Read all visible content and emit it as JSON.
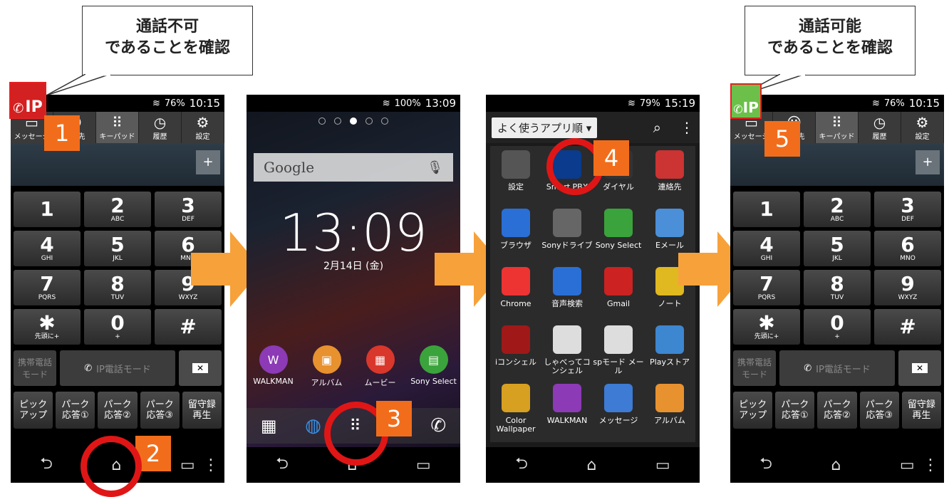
{
  "callouts": {
    "left": {
      "line1": "通話不可",
      "line2": "であることを確認"
    },
    "right": {
      "line1": "通話可能",
      "line2": "であることを確認"
    }
  },
  "steps": [
    "1",
    "2",
    "3",
    "4",
    "5"
  ],
  "dialer": {
    "status_time": "10:15",
    "battery": "76%",
    "tabs": [
      "メッセージ",
      "連絡先",
      "キーパッド",
      "履歴",
      "設定"
    ],
    "keys": [
      {
        "d": "1",
        "l": ""
      },
      {
        "d": "2",
        "l": "ABC"
      },
      {
        "d": "3",
        "l": "DEF"
      },
      {
        "d": "4",
        "l": "GHI"
      },
      {
        "d": "5",
        "l": "JKL"
      },
      {
        "d": "6",
        "l": "MNO"
      },
      {
        "d": "7",
        "l": "PQRS"
      },
      {
        "d": "8",
        "l": "TUV"
      },
      {
        "d": "9",
        "l": "WXYZ"
      },
      {
        "d": "✱",
        "l": "先頭に+"
      },
      {
        "d": "0",
        "l": "+"
      },
      {
        "d": "#",
        "l": ""
      }
    ],
    "mode_left": "携帯電話\nモード",
    "mode_center": "IP電話モード",
    "soft": [
      "ピック\nアップ",
      "パーク\n応答①",
      "パーク\n応答②",
      "パーク\n応答③",
      "留守録\n再生"
    ],
    "ip_off_label": "IP",
    "ip_on_label": "IP"
  },
  "home": {
    "status_time": "13:09",
    "battery": "100%",
    "search_label": "Google",
    "clock": "13:09",
    "date": "2月14日 (金)",
    "apps": [
      "WALKMAN",
      "アルバム",
      "ムービー",
      "Sony Select"
    ]
  },
  "drawer": {
    "status_time": "15:19",
    "battery": "79%",
    "sort_label": "よく使うアプリ順 ▾",
    "apps": [
      "設定",
      "Smart PBX",
      "ダイヤル",
      "連絡先",
      "ブラウザ",
      "Sonyドライブ",
      "Sony Select",
      "Eメール",
      "Chrome",
      "音声検索",
      "Gmail",
      "ノート",
      "iコンシェル",
      "しゃべってコンシェル",
      "spモード メール",
      "Playストア",
      "Color Wallpaper",
      "WALKMAN",
      "メッセージ",
      "アルバム"
    ]
  },
  "colors": {
    "accent_orange": "#f26d1b",
    "arrow": "#f7a13a",
    "highlight_red": "#e01616",
    "ip_on": "#6cc04a",
    "ip_off": "#d32020"
  }
}
